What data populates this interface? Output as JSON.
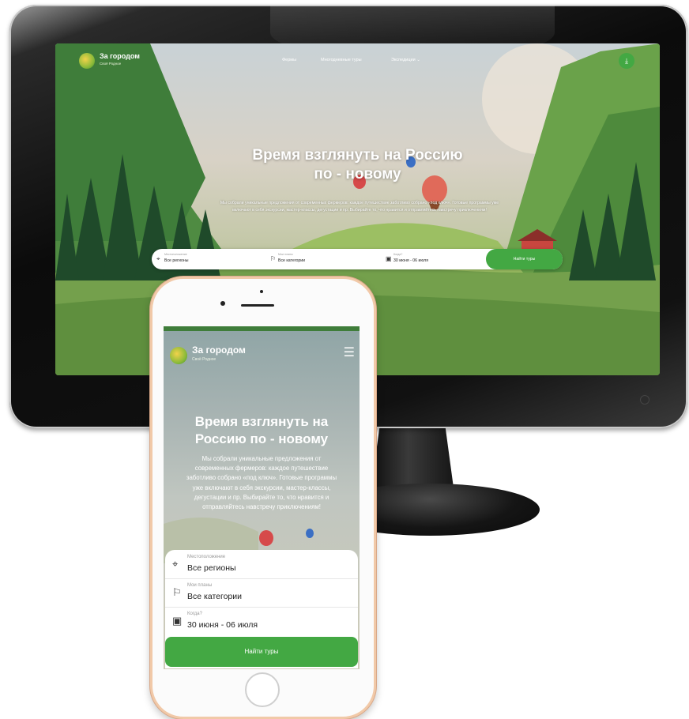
{
  "desktop": {
    "brand": "За городом",
    "brand_sub": "Своё Родное",
    "nav": [
      "Фермы",
      "Многодневные туры",
      "Экспедиции"
    ],
    "nav_dropdown_icon": "chevron-down-icon",
    "download_icon": "download-icon",
    "hero_title_line1": "Время взглянуть на Россию",
    "hero_title_line2": "по - новому",
    "hero_desc": "Мы собрали уникальные предложения от современных фермеров: каждое путешествие заботливо собрано «под ключ». Готовые программы уже включают в себя экскурсии, мастер-классы, дегустации и пр. Выбирайте то, что нравится и отправляйтесь навстречу приключениям!",
    "search": {
      "location_label": "Местоположение",
      "location_value": "Все регионы",
      "category_label": "Мои планы",
      "category_value": "Все категории",
      "date_label": "Когда?",
      "date_value": "30 июня - 06 июля",
      "button": "Найти туры"
    }
  },
  "mobile": {
    "brand": "За городом",
    "brand_sub": "Своё Родное",
    "menu_icon": "hamburger-icon",
    "hero_title_line1": "Время взглянуть на",
    "hero_title_line2": "Россию по - новому",
    "hero_desc_lines": [
      "Мы собрали уникальные предложения от",
      "современных фермеров: каждое путешествие",
      "заботливо собрано «под ключ». Готовые программы",
      "уже включают в себя экскурсии, мастер-классы,",
      "дегустации и пр. Выбирайте то, что нравится и",
      "отправляйтесь навстречу приключениям!"
    ],
    "search": {
      "location_label": "Местоположение",
      "location_value": "Все регионы",
      "category_label": "Мои планы",
      "category_value": "Все категории",
      "date_label": "Когда?",
      "date_value": "30 июня - 06 июля",
      "button": "Найти туры"
    }
  },
  "colors": {
    "accent_green": "#43a843",
    "phone_frame": "#f1c9a8",
    "monitor_bezel": "#0b0b0b"
  }
}
